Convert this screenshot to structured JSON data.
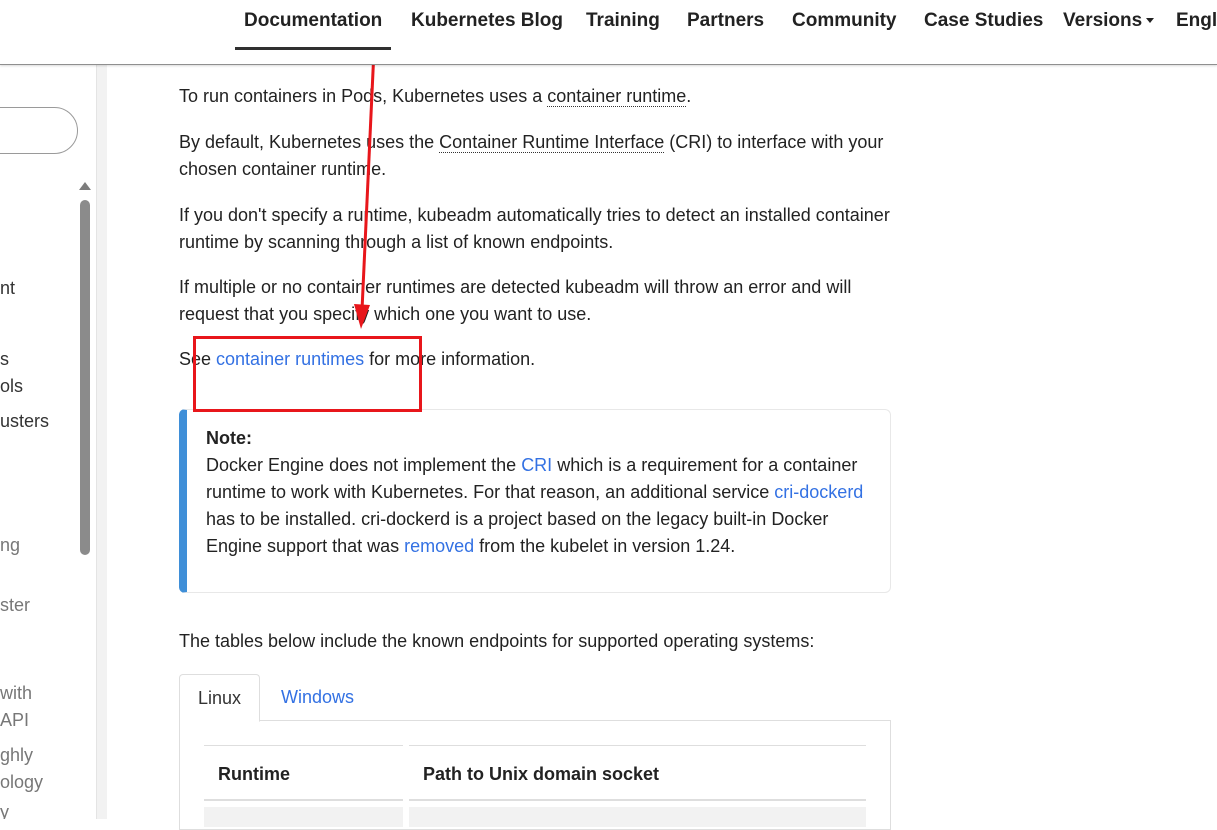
{
  "nav": {
    "items": [
      {
        "label": "Documentation",
        "active": true
      },
      {
        "label": "Kubernetes Blog"
      },
      {
        "label": "Training"
      },
      {
        "label": "Partners"
      },
      {
        "label": "Community"
      },
      {
        "label": "Case Studies"
      },
      {
        "label": "Versions"
      },
      {
        "label": "Engli"
      }
    ]
  },
  "sidebar": {
    "fragments": [
      "nt",
      "s",
      "ols",
      "usters",
      "ng",
      "ster",
      "with",
      "API",
      "ghly",
      "ology",
      "y"
    ]
  },
  "content": {
    "p1": {
      "before": "To run containers in Pods, Kubernetes uses a ",
      "link": "container runtime",
      "after": "."
    },
    "p2": {
      "before": "By default, Kubernetes uses the ",
      "link": "Container Runtime Interface",
      "after": " (CRI) to interface with your chosen container runtime."
    },
    "p3": "If you don't specify a runtime, kubeadm automatically tries to detect an installed container runtime by scanning through a list of known endpoints.",
    "p4": "If multiple or no container runtimes are detected kubeadm will throw an error and will request that you specify which one you want to use.",
    "p5": {
      "before": "See ",
      "link": "container runtimes",
      "after": " for more information."
    },
    "note": {
      "title": "Note:",
      "t1": "Docker Engine does not implement the ",
      "l1": "CRI",
      "t2": " which is a requirement for a container runtime to work with Kubernetes. For that reason, an additional service ",
      "l2": "cri-dockerd",
      "t3": " has to be installed. cri-dockerd is a project based on the legacy built-in Docker Engine support that was ",
      "l3": "removed",
      "t4": " from the kubelet in version 1.24."
    },
    "p6": "The tables below include the known endpoints for supported operating systems:",
    "tabs": [
      "Linux",
      "Windows"
    ],
    "table": {
      "headers": [
        "Runtime",
        "Path to Unix domain socket"
      ]
    }
  },
  "colors": {
    "link": "#3371e3",
    "note_accent": "#3f8fd8",
    "annotation": "#e8161b"
  }
}
